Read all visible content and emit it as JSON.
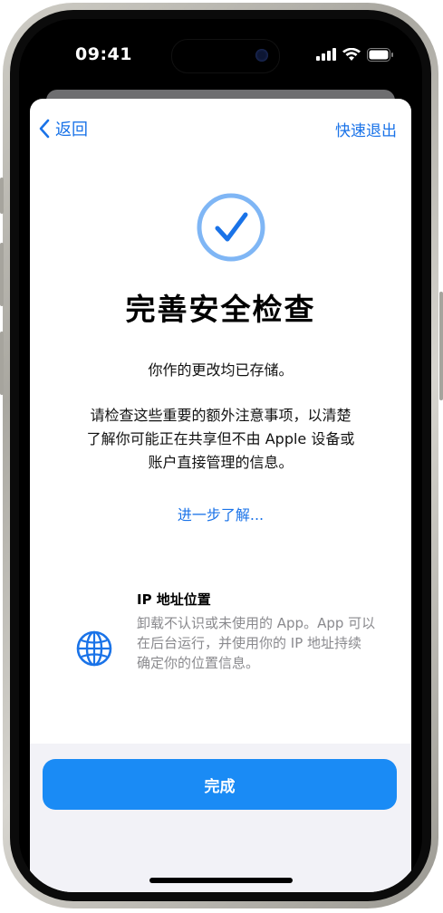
{
  "status_bar": {
    "time": "09:41",
    "icons": [
      "cellular-signal-icon",
      "wifi-icon",
      "battery-icon"
    ]
  },
  "nav": {
    "back_label": "返回",
    "quick_exit_label": "快速退出"
  },
  "main": {
    "check_icon": "checkmark-circle-icon",
    "title": "完善安全检查",
    "subtitle": "你作的更改均已存储。",
    "body_line1": "请检查这些重要的额外注意事项，以清楚",
    "body_line2": "了解你可能正在共享但不由 Apple 设备或",
    "body_line3": "账户直接管理的信息。",
    "learn_more": "进一步了解..."
  },
  "feature": {
    "icon": "globe-icon",
    "title": "IP 地址位置",
    "desc_line1": "卸载不认识或未使用的 App。App 可以",
    "desc_line2": "在后台运行，并使用你的 IP 地址持续",
    "desc_line3": "确定你的位置信息。"
  },
  "footer": {
    "done_label": "完成"
  },
  "colors": {
    "accent": "#1a73e8",
    "button": "#1a8bf5",
    "check_ring": "#7fb6f5"
  }
}
